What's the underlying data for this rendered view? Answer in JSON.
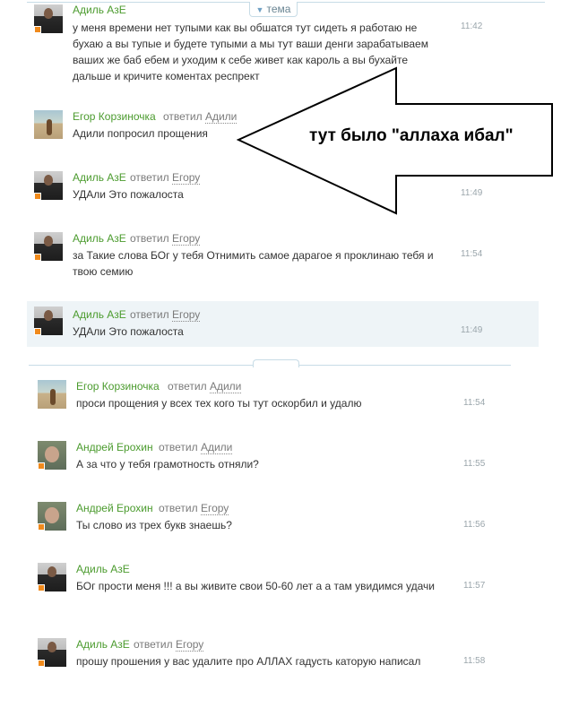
{
  "thread_tab_label": "тема",
  "annotation": "тут было \"аллаха ибал\"",
  "messages": [
    {
      "author": "Адиль АзЕ",
      "text": "у меня времени нет тупыми как вы обшатся тут сидеть я работаю не бухаю а вы тупые и будете тупыми а мы тут ваши денги зарабатываем ваших же баб ебем и уходим к себе живет как кароль а вы бухайте дальше и кричите коментах респрект",
      "time": "11:42",
      "avatar": "man"
    },
    {
      "author": "Егор Корзиночка",
      "reply_label": "ответил",
      "reply_to": "Адили",
      "text": "Адили попросил прощения",
      "time": "",
      "avatar": "beach"
    },
    {
      "author": "Адиль АзЕ",
      "reply_label": "ответил",
      "reply_to": "Егору",
      "text": "УДАли Это пожалоста",
      "time": "11:49",
      "avatar": "man"
    },
    {
      "author": "Адиль АзЕ",
      "reply_label": "ответил",
      "reply_to": "Егору",
      "text": "за Такие слова БОг у тебя Отнимить самое дарагое я проклинаю тебя и твою семию",
      "time": "11:54",
      "avatar": "man"
    },
    {
      "author": "Адиль АзЕ",
      "reply_label": "ответил",
      "reply_to": "Егору",
      "text": "УДАли Это пожалоста",
      "time": "11:49",
      "avatar": "man"
    },
    {
      "author": "Егор Корзиночка",
      "reply_label": "ответил",
      "reply_to": "Адили",
      "text": "проси прощения у всех тех кого ты тут оскорбил и удалю",
      "time": "11:54",
      "avatar": "beach"
    },
    {
      "author": "Андрей Ерохин",
      "reply_label": "ответил",
      "reply_to": "Адили",
      "text": "А за что у тебя грамотность отняли?",
      "time": "11:55",
      "avatar": "man2"
    },
    {
      "author": "Андрей Ерохин",
      "reply_label": "ответил",
      "reply_to": "Егору",
      "text": "Ты слово из трех букв знаешь?",
      "time": "11:56",
      "avatar": "man2"
    },
    {
      "author": "Адиль АзЕ",
      "text": "БОг прости меня !!! а вы  живите свои 50-60 лет а а там увидимся удачи",
      "time": "11:57",
      "avatar": "man"
    },
    {
      "author": "Адиль АзЕ",
      "reply_label": "ответил",
      "reply_to": "Егору",
      "text": "прошу прошения у вас удалите про АЛЛАХ гадусть каторую написал",
      "time": "11:58",
      "avatar": "man"
    }
  ]
}
